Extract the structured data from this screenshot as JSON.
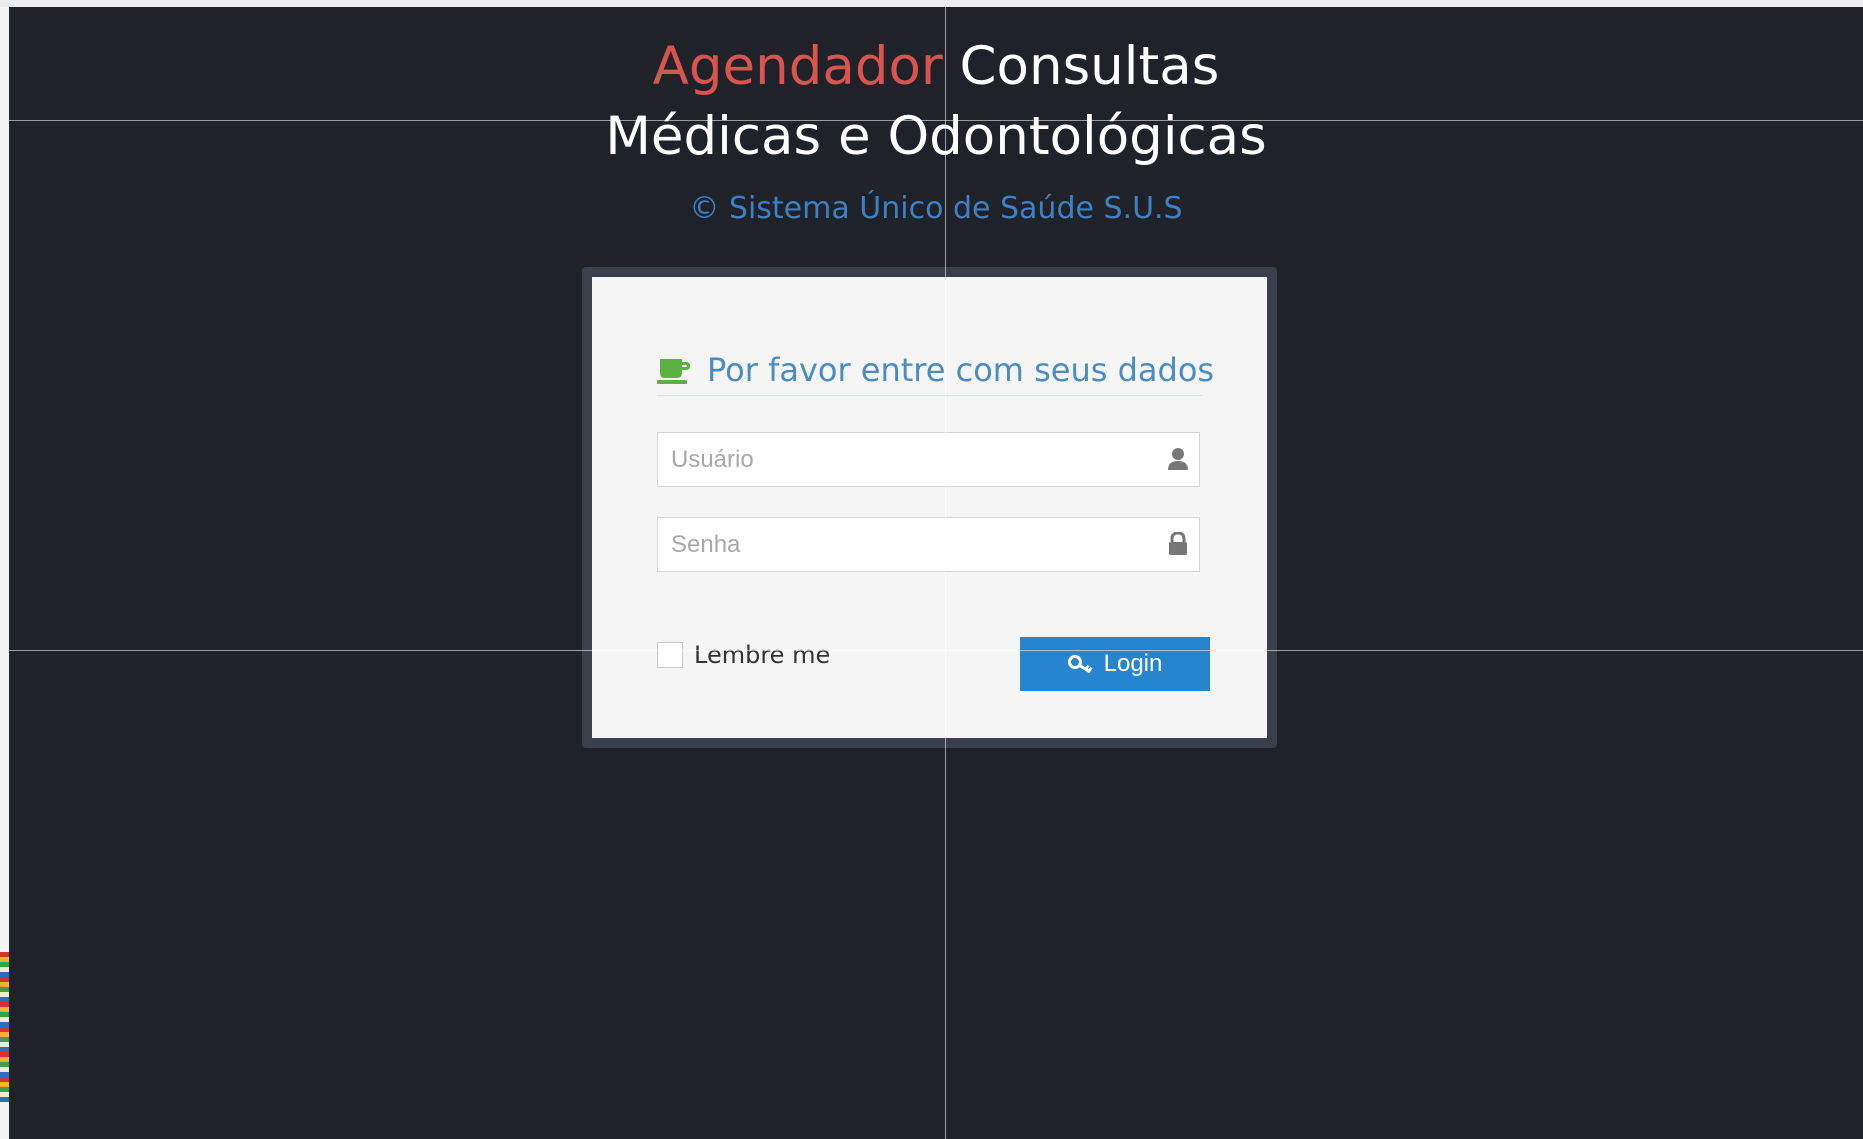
{
  "header": {
    "title_accent": "Agendador",
    "title_rest": "Consultas",
    "title_line2": "Médicas e Odontológicas",
    "subtitle": "© Sistema Único de Saúde S.U.S"
  },
  "login": {
    "heading": "Por favor entre com seus dados",
    "heading_icon": "coffee-cup-icon",
    "username": {
      "placeholder": "Usuário",
      "value": "",
      "icon": "user-icon"
    },
    "password": {
      "placeholder": "Senha",
      "value": "",
      "icon": "lock-icon"
    },
    "remember_label": "Lembre me",
    "remember_checked": false,
    "submit_label": "Login",
    "submit_icon": "key-icon"
  },
  "colors": {
    "background": "#1f2229",
    "accent_red": "#d9534f",
    "subtitle_blue": "#3f7fc4",
    "heading_blue": "#4a8bc2",
    "button_blue": "#2785cf",
    "icon_green": "#5cb240"
  }
}
